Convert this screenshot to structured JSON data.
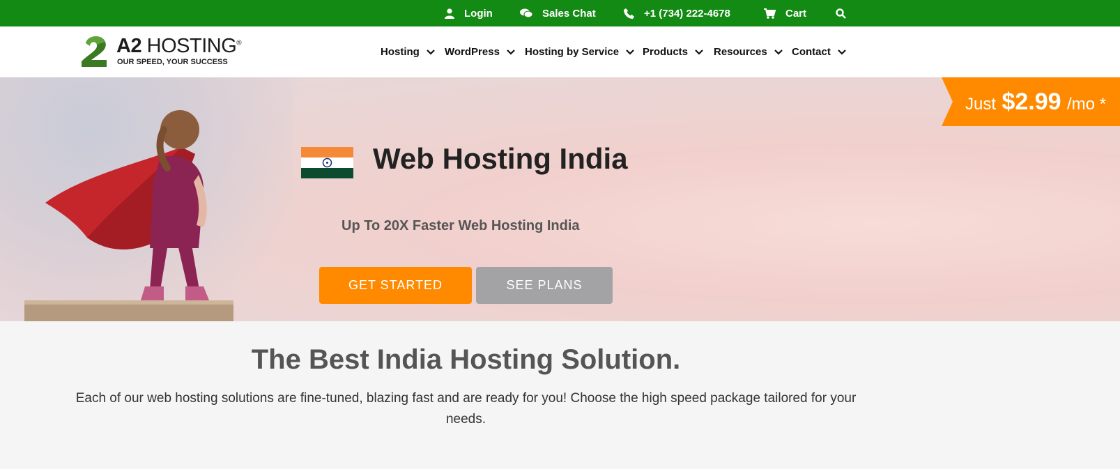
{
  "topbar": {
    "login": "Login",
    "sales_chat": "Sales Chat",
    "phone": "+1 (734) 222-4678",
    "cart": "Cart"
  },
  "header": {
    "logo_brand_bold": "A2",
    "logo_brand_rest": "HOSTING",
    "logo_tagline": "OUR SPEED, YOUR SUCCESS",
    "nav": [
      "Hosting",
      "WordPress",
      "Hosting by Service",
      "Products",
      "Resources",
      "Contact"
    ]
  },
  "hero": {
    "price_prefix": "Just",
    "price": "$2.99",
    "price_suffix": "/mo *",
    "title": "Web Hosting India",
    "subtitle": "Up To 20X Faster Web Hosting India",
    "get_started": "GET STARTED",
    "see_plans": "SEE PLANS"
  },
  "section": {
    "title": "The Best India Hosting Solution.",
    "text": "Each of our web hosting solutions are fine-tuned, blazing fast and are ready for you! Choose the high speed package tailored for your needs."
  },
  "colors": {
    "topbar": "#138a13",
    "accent_orange": "#ff8a00",
    "button_gray": "#a3a3a5"
  }
}
